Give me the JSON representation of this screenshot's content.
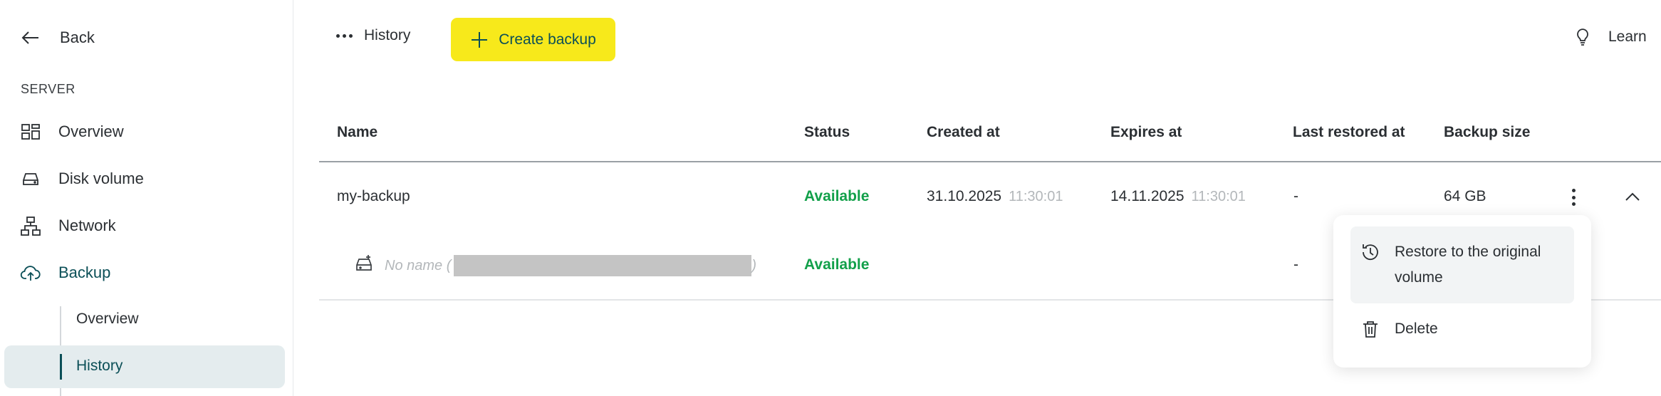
{
  "sidebar": {
    "back_label": "Back",
    "section_label": "SERVER",
    "items": [
      {
        "label": "Overview",
        "icon": "grid-icon"
      },
      {
        "label": "Disk volume",
        "icon": "disk-icon"
      },
      {
        "label": "Network",
        "icon": "network-icon"
      },
      {
        "label": "Backup",
        "icon": "cloud-upload-icon",
        "active": true
      }
    ],
    "sub_items": [
      {
        "label": "Overview"
      },
      {
        "label": "History",
        "active": true
      }
    ]
  },
  "toolbar": {
    "history_label": "History",
    "create_label": "Create backup",
    "learn_label": "Learn"
  },
  "table": {
    "headers": [
      "Name",
      "Status",
      "Created at",
      "Expires at",
      "Last restored at",
      "Backup size"
    ],
    "rows": [
      {
        "name": "my-backup",
        "status": "Available",
        "created_date": "31.10.2025",
        "created_time": "11:30:01",
        "expires_date": "14.11.2025",
        "expires_time": "11:30:01",
        "last_restored": "-",
        "size": "64 GB"
      }
    ],
    "sub_rows": [
      {
        "name": "No name (",
        "name_tail": ")",
        "status": "Available",
        "last_restored": "-"
      }
    ]
  },
  "menu": {
    "items": [
      {
        "label": "Restore to the original volume",
        "line1": "Restore to the original",
        "line2": "volume",
        "icon": "history-restore-icon"
      },
      {
        "label": "Delete",
        "icon": "trash-icon"
      }
    ]
  },
  "colors": {
    "accent": "#f7e91b",
    "brand": "#0b4f57",
    "status_available": "#12a04a"
  }
}
